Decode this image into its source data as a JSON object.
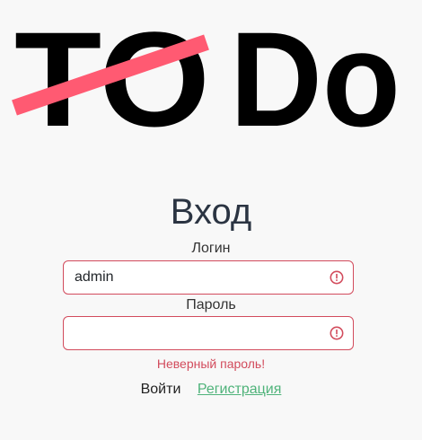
{
  "logo": {
    "text_struck": "TO",
    "text_main": "Do",
    "strike_color": "#ff5a72",
    "text_color": "#000000"
  },
  "form": {
    "heading": "Вход",
    "login_label": "Логин",
    "login_value": "admin",
    "password_label": "Пароль",
    "password_value": "",
    "error_message": "Неверный пароль!",
    "error_color": "#d24b5c",
    "error_icon": "exclamation-circle-icon",
    "submit_label": "Войти",
    "register_label": "Регистрация",
    "register_color": "#4fb37a"
  }
}
